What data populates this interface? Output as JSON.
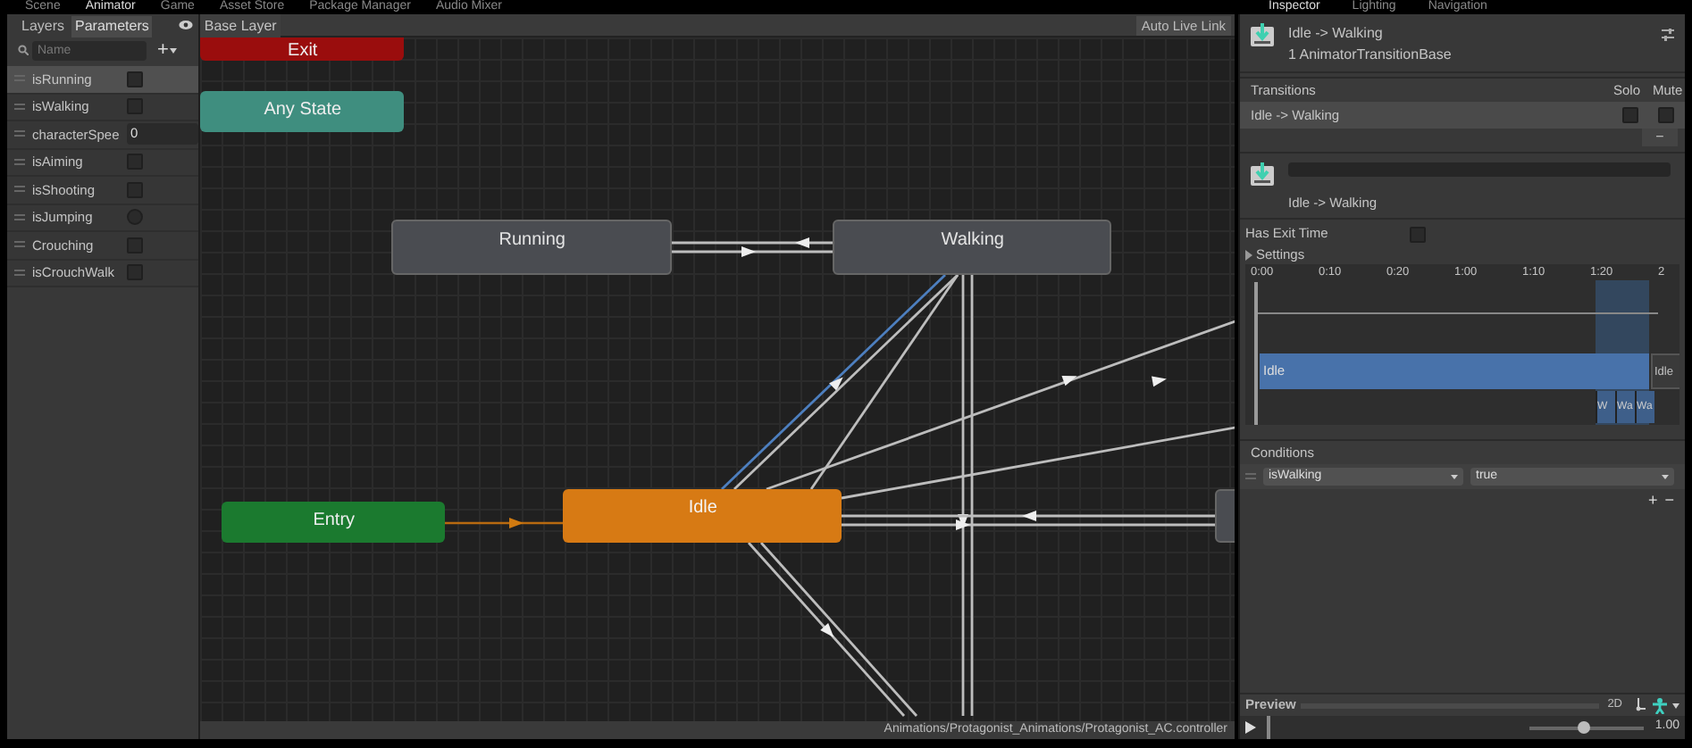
{
  "editor_tabs": [
    {
      "label": "Scene",
      "selected": false
    },
    {
      "label": "Animator",
      "selected": true
    },
    {
      "label": "Game",
      "selected": false
    },
    {
      "label": "Asset Store",
      "selected": false
    },
    {
      "label": "Package Manager",
      "selected": false
    },
    {
      "label": "Audio Mixer",
      "selected": false
    }
  ],
  "left_panel": {
    "tabs": [
      {
        "label": "Layers",
        "selected": false
      },
      {
        "label": "Parameters",
        "selected": true
      }
    ],
    "search": {
      "placeholder": "Name"
    },
    "add_button": "+",
    "parameters": [
      {
        "name": "isRunning",
        "kind": "bool",
        "checked": false,
        "selected": true
      },
      {
        "name": "isWalking",
        "kind": "bool",
        "checked": false,
        "selected": false
      },
      {
        "name": "characterSpee",
        "kind": "float",
        "value": "0",
        "selected": false
      },
      {
        "name": "isAiming",
        "kind": "bool",
        "checked": false,
        "selected": false
      },
      {
        "name": "isShooting",
        "kind": "bool",
        "checked": false,
        "selected": false
      },
      {
        "name": "isJumping",
        "kind": "trigger",
        "selected": false
      },
      {
        "name": "Crouching",
        "kind": "bool",
        "checked": false,
        "selected": false
      },
      {
        "name": "isCrouchWalk",
        "kind": "bool",
        "checked": false,
        "selected": false
      }
    ]
  },
  "graph": {
    "breadcrumb": "Base Layer",
    "auto_live_link": "Auto Live Link",
    "nodes": [
      {
        "label": "Exit",
        "kind": "exit"
      },
      {
        "label": "Any State",
        "kind": "any"
      },
      {
        "label": "Running",
        "kind": "state"
      },
      {
        "label": "Walking",
        "kind": "state"
      },
      {
        "label": "Entry",
        "kind": "entry"
      },
      {
        "label": "Idle",
        "kind": "default"
      },
      {
        "kind": "state"
      }
    ],
    "status_path": "Animations/Protagonist_Animations/Protagonist_AC.controller"
  },
  "inspector": {
    "tabs": [
      {
        "label": "Inspector",
        "selected": true
      },
      {
        "label": "Lighting",
        "selected": false
      },
      {
        "label": "Navigation",
        "selected": false
      }
    ],
    "title": "Idle -> Walking",
    "subtitle": "1 AnimatorTransitionBase",
    "transitions": {
      "header": "Transitions",
      "solo": "Solo",
      "mute": "Mute",
      "rows": [
        {
          "label": "Idle -> Walking",
          "solo": false,
          "mute": false
        }
      ],
      "remove": "−"
    },
    "transition_name": "Idle -> Walking",
    "has_exit_time": {
      "label": "Has Exit Time",
      "checked": false
    },
    "settings": "Settings",
    "timeline": {
      "ticks": [
        "0:00",
        "0:10",
        "0:20",
        "1:00",
        "1:10",
        "1:20",
        "2"
      ],
      "source": "Idle",
      "target": "Idle",
      "clips": [
        "W",
        "Wa",
        "Wa"
      ]
    },
    "conditions": {
      "header": "Conditions",
      "rows": [
        {
          "parameter": "isWalking",
          "value": "true"
        }
      ],
      "add": "+",
      "remove": "−"
    },
    "preview": {
      "label": "Preview",
      "mode": "2D",
      "speed": "1.00",
      "level": 0.47
    }
  }
}
